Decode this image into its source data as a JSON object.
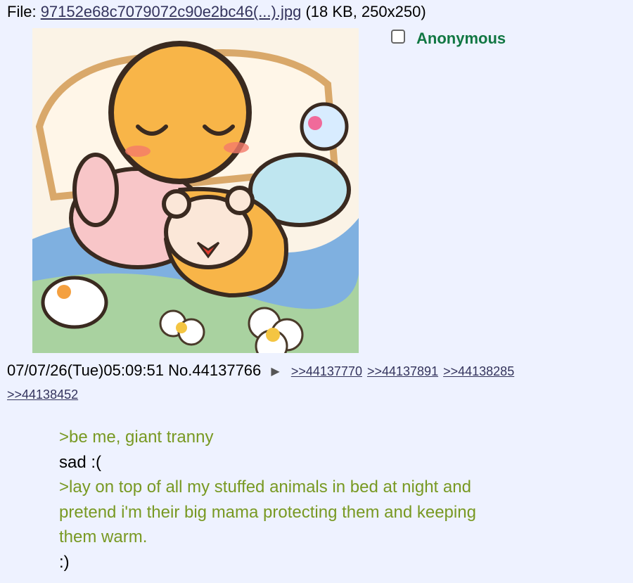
{
  "file": {
    "prefix": "File: ",
    "name": "97152e68c7079072c90e2bc46(...).jpg",
    "meta": " (18 KB, 250x250)"
  },
  "post": {
    "name": "Anonymous",
    "datetime": "07/07/26(Tue)05:09:51",
    "number": "No.44137766",
    "backlinks": [
      ">>44137770",
      ">>44137891",
      ">>44138285",
      ">>44138452"
    ]
  },
  "message": {
    "lines": [
      {
        "text": ">be me, giant tranny",
        "greentext": true
      },
      {
        "text": "sad :(",
        "greentext": false
      },
      {
        "text": ">lay on top of all my stuffed animals in bed at night and",
        "greentext": true
      },
      {
        "text": "pretend i'm their big mama protecting them and keeping",
        "greentext": true
      },
      {
        "text": "them warm.",
        "greentext": true
      },
      {
        "text": ":)",
        "greentext": false
      }
    ]
  },
  "colors": {
    "background": "#eef2ff",
    "name": "#117743",
    "link": "#34345c",
    "greentext": "#789922"
  },
  "icons": [
    "checkbox-icon",
    "menu-arrow-icon"
  ]
}
